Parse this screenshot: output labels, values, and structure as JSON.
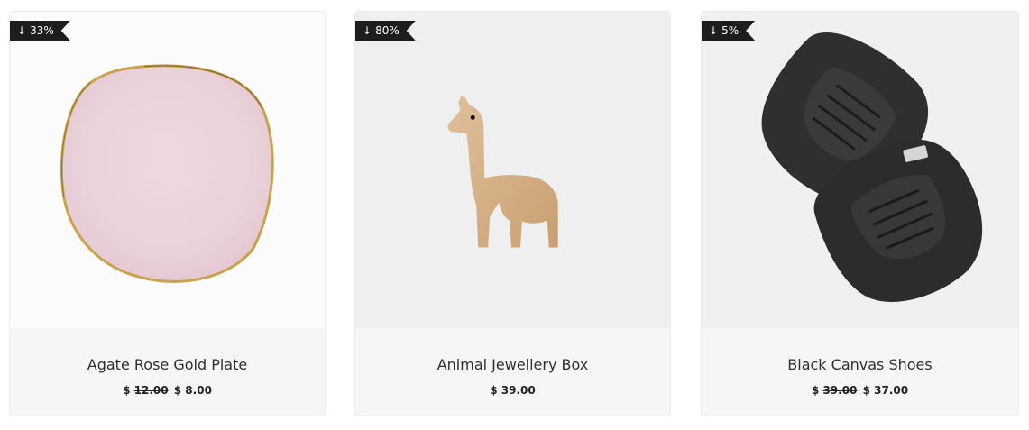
{
  "products": [
    {
      "name": "Agate Rose Gold Plate",
      "discount": "33%",
      "old_price_symbol": "$",
      "old_price": "12.00",
      "price": "$ 8.00",
      "image_icon": "pink-plate-image"
    },
    {
      "name": "Animal Jewellery Box",
      "discount": "80%",
      "price": "$ 39.00",
      "image_icon": "wooden-llama-image"
    },
    {
      "name": "Black Canvas Shoes",
      "discount": "5%",
      "old_price_symbol": "$",
      "old_price": "39.00",
      "price": "$ 37.00",
      "image_icon": "black-shoes-image"
    }
  ],
  "badge_arrow": "↓",
  "colors": {
    "badge_bg": "#1d1d1d",
    "plate_pink": "#ecd5dc",
    "plate_gold": "#c9a24a",
    "llama_wood": "#d6b48e",
    "shoe_black": "#2f2f2f"
  }
}
